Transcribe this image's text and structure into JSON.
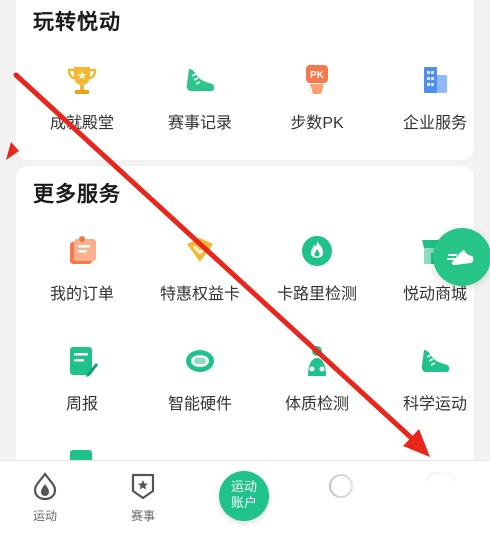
{
  "play_section": {
    "title": "玩转悦动",
    "items": [
      {
        "label": "成就殿堂",
        "icon": "trophy-icon"
      },
      {
        "label": "赛事记录",
        "icon": "shoe-icon"
      },
      {
        "label": "步数PK",
        "icon": "pk-icon"
      },
      {
        "label": "企业服务",
        "icon": "building-icon"
      }
    ]
  },
  "more_section": {
    "title": "更多服务",
    "items": [
      {
        "label": "我的订单",
        "icon": "order-icon"
      },
      {
        "label": "特惠权益卡",
        "icon": "heart-card-icon"
      },
      {
        "label": "卡路里检测",
        "icon": "flame-icon"
      },
      {
        "label": "悦动商城",
        "icon": "shop-icon"
      },
      {
        "label": "周报",
        "icon": "report-icon"
      },
      {
        "label": "智能硬件",
        "icon": "band-icon"
      },
      {
        "label": "体质检测",
        "icon": "body-icon"
      },
      {
        "label": "科学运动",
        "icon": "shoe-icon"
      }
    ]
  },
  "bottom_nav": {
    "items": [
      {
        "label": "运动",
        "icon": "drop-icon"
      },
      {
        "label": "赛事",
        "icon": "badge-icon"
      }
    ],
    "center_line1": "运动",
    "center_line2": "账户"
  },
  "colors": {
    "accent": "#1fc28a",
    "annotation_arrow": "#e8261c"
  }
}
